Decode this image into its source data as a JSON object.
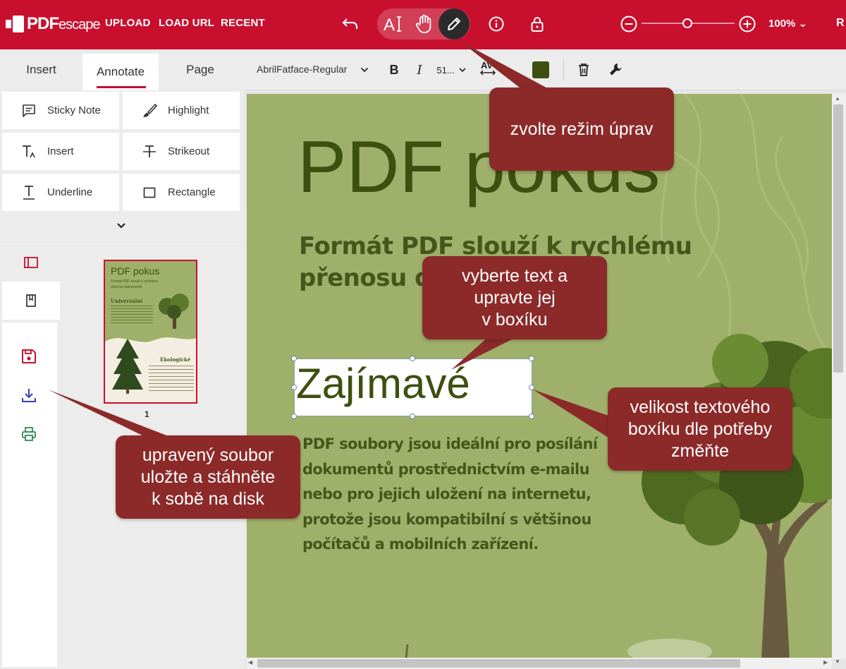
{
  "topbar": {
    "logo_main": "PDF",
    "logo_sub": "escape",
    "nav": [
      "UPLOAD",
      "LOAD URL",
      "RECENT"
    ],
    "zoom": "100%",
    "cut_label": "R"
  },
  "left_tabs": [
    "Insert",
    "Annotate",
    "Page"
  ],
  "tools": [
    {
      "label": "Sticky Note",
      "icon": "comment-icon"
    },
    {
      "label": "Highlight",
      "icon": "brush-icon"
    },
    {
      "label": "Insert",
      "icon": "insert-text-icon"
    },
    {
      "label": "Strikeout",
      "icon": "strikeout-icon"
    },
    {
      "label": "Underline",
      "icon": "underline-icon"
    },
    {
      "label": "Rectangle",
      "icon": "rectangle-icon"
    }
  ],
  "format_bar": {
    "font": "AbrilFatface-Regular",
    "size": "51...",
    "text_color": "#3d5010"
  },
  "thumbnail": {
    "page_number": "1",
    "title": "PDF pokus",
    "subtitle": "Formát PDF slouží k rychlému přenosu dokumentů",
    "heading1": "Univerzální",
    "heading2": "Ekologické"
  },
  "document": {
    "title": "PDF pokus",
    "subtitle": "Formát PDF slouží k rychlému přenosu dokumentů",
    "edit_text": "Zajímavé",
    "body_lines": [
      "PDF soubory jsou ideální pro posílání",
      "dokumentů prostřednictvím e-mailu",
      "nebo pro jejich uložení na internetu,",
      "protože jsou kompatibilní s většinou",
      "počítačů a mobilních zařízení."
    ]
  },
  "callouts": {
    "edit_mode": "zvolte režim úprav",
    "select_text": [
      "vyberte text a",
      "upravte jej",
      "v boxíku"
    ],
    "resize_box": [
      "velikost textového",
      "boxíku dle potřeby",
      "změňte"
    ],
    "save_download": [
      "upravený soubor",
      "uložte a stáhněte",
      "k sobě na disk"
    ]
  },
  "colors": {
    "brand": "#c8102e",
    "callout": "#8c2a2a",
    "page_bg": "#9fb06a",
    "text_dark": "#3d5010"
  }
}
